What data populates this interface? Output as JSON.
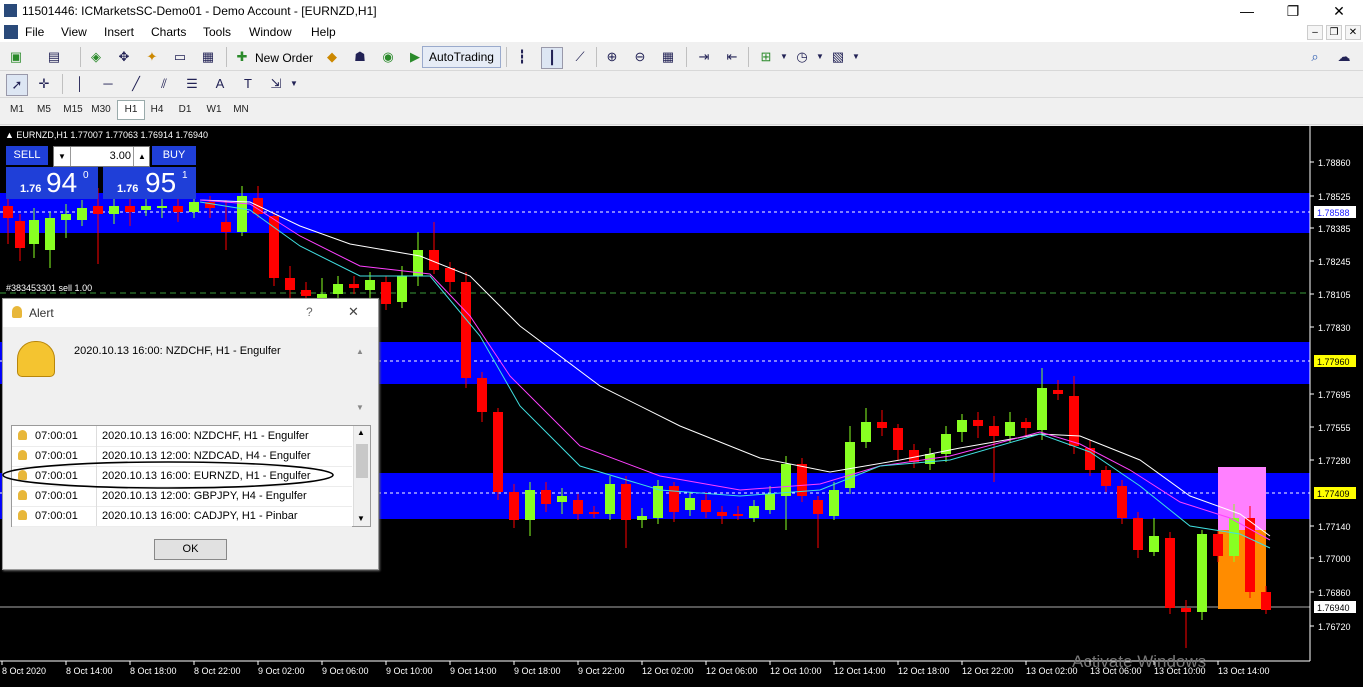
{
  "window": {
    "title": "11501446: ICMarketsSC-Demo01 - Demo Account - [EURNZD,H1]",
    "minimize": "—",
    "maximize": "❐",
    "close": "✕"
  },
  "menu": [
    "File",
    "View",
    "Insert",
    "Charts",
    "Tools",
    "Window",
    "Help"
  ],
  "toolbar": {
    "new_order": "New Order",
    "autotrading": "AutoTrading"
  },
  "timeframes": [
    "M1",
    "M5",
    "M15",
    "M30",
    "H1",
    "H4",
    "D1",
    "W1",
    "MN"
  ],
  "active_timeframe": "H1",
  "chart": {
    "header": "▲ EURNZD,H1  1.77007 1.77063 1.76914 1.76940",
    "order_line_label": "#383453301 sell 1.00",
    "one_click": {
      "sell": "SELL",
      "buy": "BUY",
      "lots": "3.00",
      "sell_big": "1.76",
      "sell_digits": "94",
      "sell_sup": "0",
      "buy_big": "1.76",
      "buy_digits": "95",
      "buy_sup": "1"
    },
    "price_labels": [
      "1.78860",
      "1.78525",
      "1.78385",
      "1.78245",
      "1.78105",
      "1.77830",
      "1.77695",
      "1.77555",
      "1.77280",
      "1.77140",
      "1.77000",
      "1.76860",
      "1.76720"
    ],
    "highlight_labels": [
      {
        "text": "1.78588",
        "color": "#2020ff",
        "bg": "#ffffff"
      },
      {
        "text": "1.77960",
        "color": "#000000",
        "bg": "#ffff00"
      },
      {
        "text": "1.77409",
        "color": "#000000",
        "bg": "#ffff00"
      },
      {
        "text": "1.76940",
        "color": "#000000",
        "bg": "#ffffff"
      }
    ],
    "time_labels": [
      "8 Oct 2020",
      "8 Oct 14:00",
      "8 Oct 18:00",
      "8 Oct 22:00",
      "9 Oct 02:00",
      "9 Oct 06:00",
      "9 Oct 10:00",
      "9 Oct 14:00",
      "9 Oct 18:00",
      "9 Oct 22:00",
      "12 Oct 02:00",
      "12 Oct 06:00",
      "12 Oct 10:00",
      "12 Oct 14:00",
      "12 Oct 18:00",
      "12 Oct 22:00",
      "13 Oct 02:00",
      "13 Oct 06:00",
      "13 Oct 10:00",
      "13 Oct 14:00"
    ],
    "watermark": "Activate Windows",
    "colors": {
      "bull": "#88ff22",
      "bear": "#ff0000",
      "zone": "#0000ff",
      "box_top": "#ff80ff",
      "box_bottom": "#ff8c00"
    }
  },
  "alert": {
    "title": "Alert",
    "help": "?",
    "close": "✕",
    "message": "2020.10.13 16:00: NZDCHF, H1 - Engulfer",
    "rows": [
      {
        "time": "07:00:01",
        "text": "2020.10.13 16:00: NZDCHF, H1 - Engulfer"
      },
      {
        "time": "07:00:01",
        "text": "2020.10.13 12:00: NZDCAD, H4 - Engulfer"
      },
      {
        "time": "07:00:01",
        "text": "2020.10.13 16:00: EURNZD, H1 - Engulfer"
      },
      {
        "time": "07:00:01",
        "text": "2020.10.13 12:00: GBPJPY, H4 - Engulfer"
      },
      {
        "time": "07:00:01",
        "text": "2020.10.13 16:00: CADJPY, H1 - Pinbar"
      }
    ],
    "ok": "OK"
  }
}
